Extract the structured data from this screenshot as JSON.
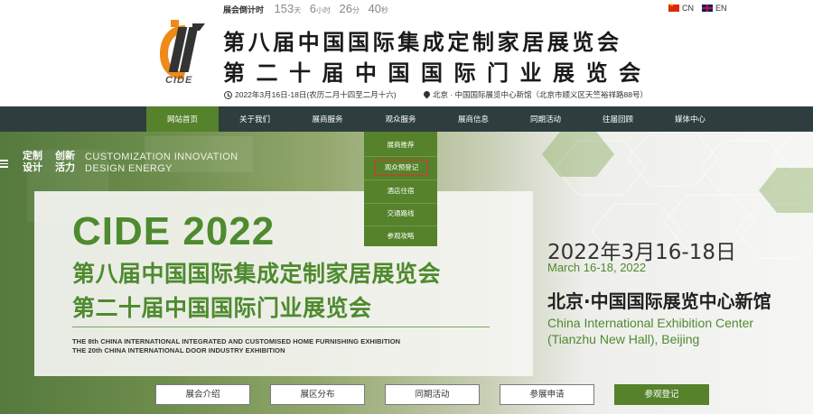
{
  "header": {
    "countdown_label": "展会倒计时",
    "countdown": [
      {
        "value": "153",
        "unit": "天"
      },
      {
        "value": "6",
        "unit": "小时"
      },
      {
        "value": "26",
        "unit": "分"
      },
      {
        "value": "40",
        "unit": "秒"
      }
    ],
    "lang_cn": "CN",
    "lang_en": "EN",
    "logo_text": "CIDE",
    "title_line1": "第八届中国国际集成定制家居展览会",
    "title_line2": "第二十届中国国际门业展览会",
    "date_info": "2022年3月16日-18日(农历二月十四至二月十六)",
    "location_info": "北京 · 中国国际展览中心新馆（北京市顺义区天竺裕祥路88号）"
  },
  "nav": {
    "items": [
      "网站首页",
      "关于我们",
      "展商服务",
      "观众服务",
      "展商信息",
      "同期活动",
      "往届回顾",
      "媒体中心"
    ],
    "active_index": 0
  },
  "dropdown": {
    "items": [
      "展商推荐",
      "观众预登记",
      "酒店住宿",
      "交通路线",
      "参观攻略"
    ],
    "highlighted_index": 1
  },
  "banner": {
    "tagline_cn_1": "定制",
    "tagline_cn_2": "设计",
    "tagline_cn_3": "创新",
    "tagline_cn_4": "活力",
    "tagline_en_1": "CUSTOMIZATION INNOVATION",
    "tagline_en_2": "DESIGN ENERGY",
    "headline": "CIDE 2022",
    "cn_line1": "第八届中国国际集成定制家居展览会",
    "cn_line2": "第二十届中国国际门业展览会",
    "en_line1": "THE 8th CHINA INTERNATIONAL INTEGRATED AND CUSTOMISED HOME FURNISHING EXHIBITION",
    "en_line2": "THE 20th CHINA INTERNATIONAL DOOR INDUSTRY EXHIBITION",
    "date_cn": "2022年3月16-18日",
    "date_en": "March 16-18, 2022",
    "venue_cn": "北京·中国国际展览中心新馆",
    "venue_en_1": "China International Exhibition Center",
    "venue_en_2": "(Tianzhu New Hall), Beijing"
  },
  "buttons": [
    "展会介绍",
    "展区分布",
    "同期活动",
    "参展申请",
    "参观登记"
  ],
  "colors": {
    "nav_bg": "#2e3e3f",
    "accent_green": "#55822a",
    "brand_green": "#4e8a2e",
    "highlight_red": "#e0332b"
  }
}
